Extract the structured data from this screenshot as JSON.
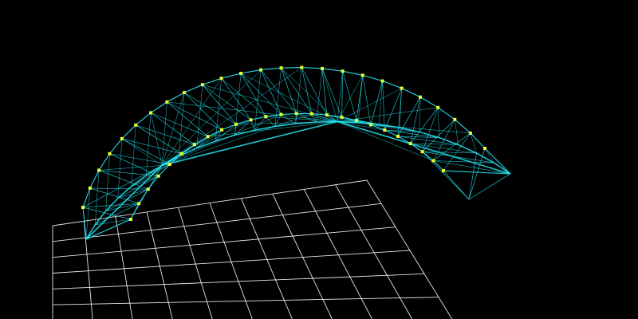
{
  "viewport": {
    "background_color": "#000000",
    "grid_color": "#ffffff",
    "mesh_color": "#22e6f2",
    "vertex_color": "#ecff2a",
    "grid_visible": true,
    "wireframe_visible": true,
    "vertices_visible": true,
    "grid": {
      "columns": 10,
      "rows": 6
    }
  }
}
